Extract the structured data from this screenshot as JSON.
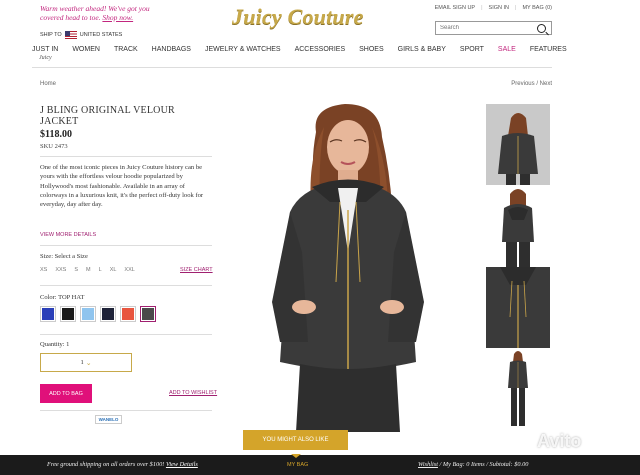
{
  "header": {
    "promo_text": "Warm weather ahead! We've got you covered head to toe.",
    "promo_link": "Shop now.",
    "ship_to_label": "SHIP TO",
    "ship_country": "UNITED STATES",
    "logo": "Juicy Couture",
    "util_links": [
      "EMAIL SIGN UP",
      "SIGN IN",
      "MY BAG (0)"
    ],
    "search_placeholder": "Search",
    "nav": [
      "JUST IN",
      "WOMEN",
      "TRACK",
      "HANDBAGS",
      "JEWELRY & WATCHES",
      "ACCESSORIES",
      "SHOES",
      "GIRLS & BABY",
      "SPORT",
      "SALE",
      "FEATURES"
    ],
    "nav_script": "Juicy"
  },
  "breadcrumb": "Home",
  "pager": {
    "prev": "Previous",
    "sep": "/",
    "next": "Next"
  },
  "product": {
    "title": "J BLING ORIGINAL VELOUR JACKET",
    "price": "$118.00",
    "sku": "SKU 2473",
    "description": "One of the most iconic pieces in Juicy Couture history can be yours with the effortless velour hoodie popularized by Hollywood's most fashionable. Available in an array of colorways in a luxurious knit, it's the perfect off-duty look for everyday, day after day.",
    "view_more": "VIEW MORE DETAILS",
    "size_label": "Size: Select a Size",
    "sizes": [
      "XS",
      "XXS",
      "S",
      "M",
      "L",
      "XL",
      "XXL"
    ],
    "size_chart": "SIZE CHART",
    "color_label": "Color: TOP HAT",
    "colors": [
      "#2a3fb8",
      "#1a1a1a",
      "#8fc4ee",
      "#1e2238",
      "#e8553f",
      "#4a4a4a"
    ],
    "selected_color_index": 5,
    "qty_label": "Quantity: 1",
    "qty_value": "1",
    "add_to_bag": "ADD TO BAG",
    "add_to_wishlist": "ADD TO WISHLIST",
    "wanelo": "WANELO"
  },
  "also_like": "YOU MIGHT ALSO LIKE",
  "footer": {
    "shipping": "Free ground shipping on all orders over $100!",
    "view_details": "View Details",
    "my_bag": "MY BAG",
    "wishlist": "Wishlist",
    "bag_summary": " / My Bag: 0 Items / Subtotal: $0.00"
  },
  "watermark": "Avito"
}
